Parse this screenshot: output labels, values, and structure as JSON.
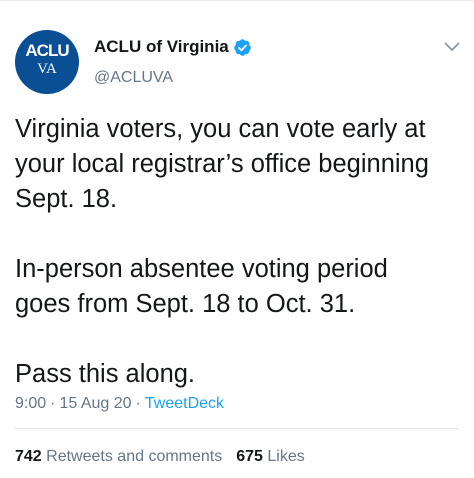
{
  "colors": {
    "avatar_bg": "#0a4e94",
    "verified": "#1da1f2",
    "link": "#1da1f2",
    "secondary_text": "#657786",
    "primary_text": "#14171a"
  },
  "author": {
    "avatar_line1": "ACLU",
    "avatar_line2": "VA",
    "display_name": "ACLU of Virginia",
    "handle": "@ACLUVA",
    "verified_icon": "verified-badge",
    "menu_icon": "chevron-down"
  },
  "tweet": {
    "paragraphs": [
      [
        "Virginia voters, you can vote early at",
        "your local registrar’s office beginning",
        "Sept. 18."
      ],
      [
        "In-person absentee voting period",
        "goes from Sept. 18 to Oct. 31."
      ],
      [
        "Pass this along."
      ]
    ]
  },
  "meta": {
    "time": "9:00",
    "separator": "·",
    "date": "15 Aug 20",
    "source": "TweetDeck"
  },
  "stats": {
    "retweets_count": "742",
    "retweets_label": "Retweets and comments",
    "likes_count": "675",
    "likes_label": "Likes"
  }
}
